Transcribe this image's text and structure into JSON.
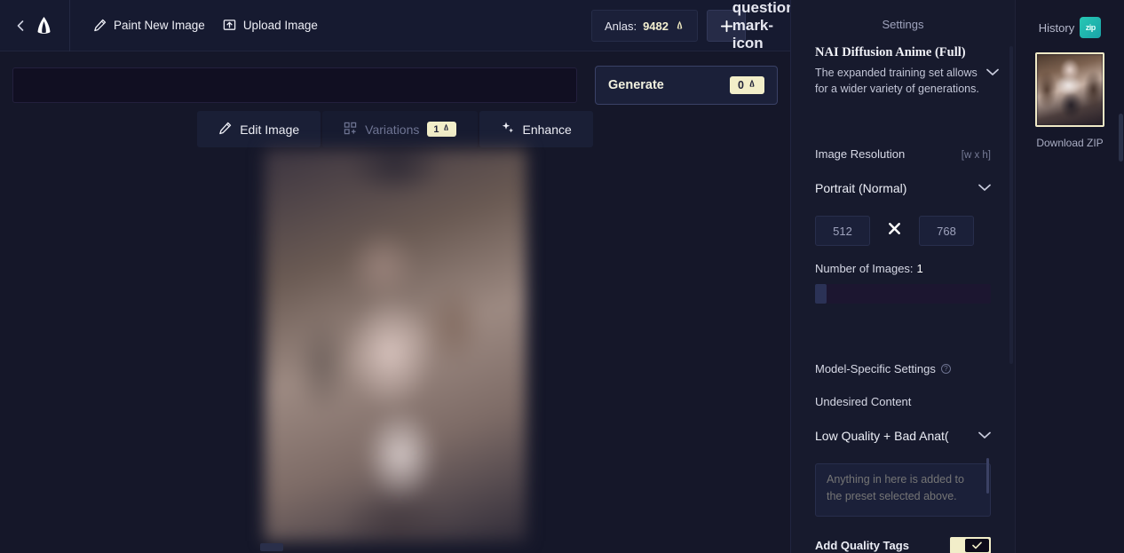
{
  "topbar": {
    "collapse_icon": "caret-left-icon",
    "logo_icon": "novelai-logo-icon",
    "paint_new_image": "Paint New Image",
    "paint_icon": "brush-icon",
    "upload_image": "Upload Image",
    "upload_icon": "upload-icon",
    "anlas_label": "Anlas:",
    "anlas_value": "9482",
    "anlas_icon": "anlas-icon",
    "add_icon": "plus-icon",
    "help_icon": "question-mark-icon"
  },
  "prompt": {
    "value": "",
    "placeholder": ""
  },
  "generate": {
    "label": "Generate",
    "cost": "0",
    "cost_icon": "anlas-icon"
  },
  "tabs": [
    {
      "label": "Edit Image",
      "icon": "brush-icon",
      "active": true,
      "badge": ""
    },
    {
      "label": "Variations",
      "icon": "grid-variations-icon",
      "active": false,
      "badge": "1"
    },
    {
      "label": "Enhance",
      "icon": "sparkles-icon",
      "active": false,
      "badge": ""
    }
  ],
  "settings": {
    "title": "Settings",
    "model": {
      "name": "NAI Diffusion Anime (Full)",
      "description": "The expanded training set allows for a wider variety of generations.",
      "chevron_icon": "chevron-down-icon"
    },
    "resolution": {
      "label": "Image Resolution",
      "hint": "[w x h]",
      "preset": "Portrait (Normal)",
      "chevron_icon": "chevron-down-icon",
      "width": "512",
      "height": "768",
      "separator_icon": "multiply-x-icon"
    },
    "number_of_images": {
      "label": "Number of Images:",
      "value": "1"
    },
    "model_specific": {
      "label": "Model-Specific Settings",
      "info_icon": "info-icon"
    },
    "undesired_content": {
      "label": "Undesired Content",
      "preset": "Low Quality + Bad Anat(",
      "chevron_icon": "chevron-down-icon",
      "textarea_value": "",
      "textarea_placeholder": "Anything in here is added to the preset selected above."
    },
    "add_quality_tags": {
      "label": "Add Quality Tags",
      "checked": true,
      "check_icon": "check-icon"
    }
  },
  "history": {
    "title": "History",
    "zip_badge_label": "zip",
    "zip_badge_icon": "zip-file-icon",
    "download_zip": "Download ZIP",
    "thumbnail_name": "history-thumbnail"
  },
  "colors": {
    "background": "#15172a",
    "panel": "#171a2d",
    "accent_cream": "#f2eec9",
    "teal_badge": "#27c8b4"
  }
}
